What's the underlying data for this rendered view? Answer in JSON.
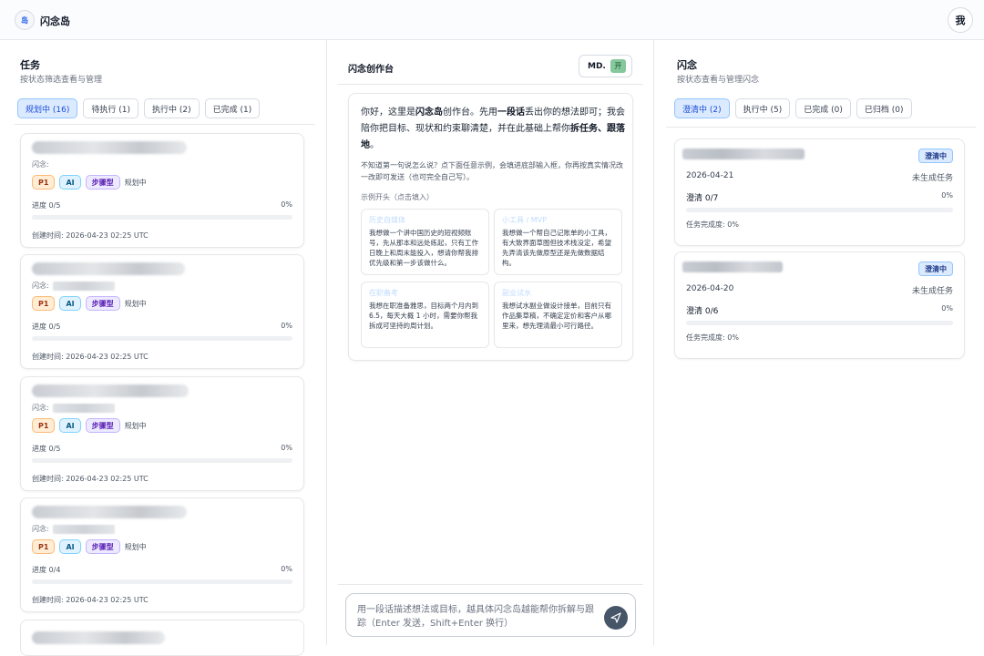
{
  "header": {
    "logo_text": "岛",
    "app_title": "闪念岛",
    "user_label": "我"
  },
  "tasks_panel": {
    "title": "任务",
    "subtitle": "按状态筛选查看与管理",
    "filters": [
      "规划中 (16)",
      "待执行 (1)",
      "执行中 (2)",
      "已完成 (1)"
    ],
    "cards": [
      {
        "idea_prefix": "闪念:",
        "tags": [
          "P1",
          "AI",
          "步骤型"
        ],
        "status": "规划中",
        "progress_label": "进度 0/5",
        "progress_pct": "0%",
        "progress_value": 0,
        "created": "创建时间: 2026-04-23 02:25 UTC"
      },
      {
        "idea_prefix": "闪念:",
        "tags": [
          "P1",
          "AI",
          "步骤型"
        ],
        "status": "规划中",
        "progress_label": "进度 0/5",
        "progress_pct": "0%",
        "progress_value": 0,
        "created": "创建时间: 2026-04-23 02:25 UTC"
      },
      {
        "idea_prefix": "闪念:",
        "tags": [
          "P1",
          "AI",
          "步骤型"
        ],
        "status": "规划中",
        "progress_label": "进度 0/5",
        "progress_pct": "0%",
        "progress_value": 0,
        "created": "创建时间: 2026-04-23 02:25 UTC"
      },
      {
        "idea_prefix": "闪念:",
        "tags": [
          "P1",
          "AI",
          "步骤型"
        ],
        "status": "规划中",
        "progress_label": "进度 0/4",
        "progress_pct": "0%",
        "progress_value": 0,
        "created": "创建时间: 2026-04-23 02:25 UTC"
      }
    ]
  },
  "workbench": {
    "title": "闪念创作台",
    "md_label": "MD.",
    "md_toggle": "开",
    "greeting_parts": [
      "你好，这里是",
      "闪念岛",
      "创作台。先用",
      "一段话",
      "丢出你的想法即可；我会陪你把目标、现状和约束聊清楚，并在此基础上帮你",
      "拆任务、跟落地",
      "。"
    ],
    "hint": "不知道第一句说怎么说？点下面任意示例，会填进底部输入框，你再按真实情况改一改即可发送（也可完全自己写）。",
    "examples_label": "示例开头（点击填入）",
    "examples": [
      {
        "title": "历史自媒体",
        "body": "我想做一个讲中国历史的短视频账号，先从那本和远处练起，只有工作日晚上和周末能投入，想请你帮我排优先级和第一步该做什么。"
      },
      {
        "title": "小工具 / MVP",
        "body": "我想做一个帮自己记账单的小工具，有大致界面草图但技术栈没定，希望先弄清该先做原型还是先做数据结构。"
      },
      {
        "title": "在职备考",
        "body": "我想在职准备雅思，目标两个月内到 6.5，每天大概 1 小时，需要你帮我拆成可坚持的周计划。"
      },
      {
        "title": "副业试水",
        "body": "我想试水副业做设计接单，目前只有作品集草稿，不确定定价和客户从哪里来，想先理清最小可行路径。"
      }
    ],
    "input_placeholder": "用一段话描述想法或目标，越具体闪念岛越能帮你拆解与跟踪（Enter 发送，Shift+Enter 换行）"
  },
  "ideas_panel": {
    "title": "闪念",
    "subtitle": "按状态查看与管理闪念",
    "filters": [
      "澄清中 (2)",
      "执行中 (5)",
      "已完成 (0)",
      "已归档 (0)"
    ],
    "cards": [
      {
        "status": "澄清中",
        "date": "2026-04-21",
        "task_state": "未生成任务",
        "clarify": "澄清 0/7",
        "pct": "0%",
        "done_rate": "任务完成度: 0%"
      },
      {
        "status": "澄清中",
        "date": "2026-04-20",
        "task_state": "未生成任务",
        "clarify": "澄清 0/6",
        "pct": "0%",
        "done_rate": "任务完成度: 0%"
      }
    ]
  },
  "colors": {
    "accent": "#3b82f6",
    "active_chip": "#dbeafe",
    "send_button": "#475569",
    "md_toggle": "#86c79b"
  }
}
